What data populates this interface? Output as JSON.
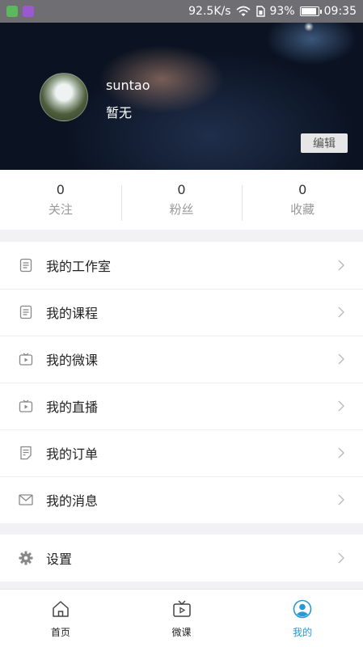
{
  "status_bar": {
    "speed": "92.5K/s",
    "battery": "93%",
    "battery_level": 0.93,
    "time": "09:35"
  },
  "profile": {
    "username": "suntao",
    "bio": "暂无",
    "edit_label": "编辑"
  },
  "stats": [
    {
      "value": "0",
      "label": "关注"
    },
    {
      "value": "0",
      "label": "粉丝"
    },
    {
      "value": "0",
      "label": "收藏"
    }
  ],
  "menu": [
    {
      "label": "我的工作室",
      "icon": "document-icon"
    },
    {
      "label": "我的课程",
      "icon": "document-icon"
    },
    {
      "label": "我的微课",
      "icon": "video-icon"
    },
    {
      "label": "我的直播",
      "icon": "video-icon"
    },
    {
      "label": "我的订单",
      "icon": "order-icon"
    },
    {
      "label": "我的消息",
      "icon": "mail-icon"
    }
  ],
  "settings": {
    "label": "设置",
    "icon": "gear-icon"
  },
  "tabs": [
    {
      "label": "首页",
      "icon": "home-icon",
      "active": false
    },
    {
      "label": "微课",
      "icon": "tv-icon",
      "active": false
    },
    {
      "label": "我的",
      "icon": "user-icon",
      "active": true
    }
  ],
  "colors": {
    "accent": "#2a97d6",
    "background": "#f2f2f4"
  }
}
